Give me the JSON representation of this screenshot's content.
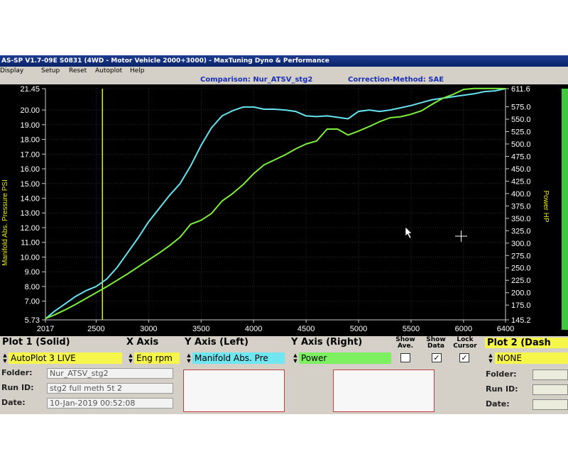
{
  "window": {
    "title": "AS-SP V1.7-09E S0831  (4WD - Motor Vehicle 2000+3000) - MaxTuning Dyno & Performance"
  },
  "menu": [
    "Display",
    "Setup",
    "Reset",
    "Autoplot",
    "Help"
  ],
  "header": {
    "comparison": "Comparison: Nur_ATSV_stg2",
    "correction": "Correction-Method: SAE"
  },
  "colors": {
    "background": "#000000",
    "manifold_trace": "#66e3f0",
    "power_trace": "#7cf03a",
    "cursor_line": "#e8e820",
    "power_bar": "#3ec83e"
  },
  "chart_data": {
    "type": "line",
    "xlabel": "",
    "ylabel_left": "Manifold Abs. Pressure PSI",
    "ylabel_right": "Power HP",
    "xlim": [
      2017,
      6400
    ],
    "ylim_left": [
      5.73,
      21.45
    ],
    "ylim_right": [
      145.2,
      611.6
    ],
    "x_ticks": [
      "2017",
      "2500",
      "3000",
      "3500",
      "4000",
      "4500",
      "5000",
      "5500",
      "6000",
      "6400"
    ],
    "y_left_ticks": [
      "21.45",
      "20.00",
      "19.00",
      "18.00",
      "17.00",
      "16.00",
      "15.00",
      "14.00",
      "13.00",
      "12.00",
      "11.00",
      "10.00",
      "9.00",
      "8.00",
      "7.00",
      "5.73"
    ],
    "y_right_ticks": [
      "611.6",
      "575.0",
      "550.0",
      "525.0",
      "500.0",
      "475.0",
      "450.0",
      "425.0",
      "400.0",
      "375.0",
      "350.0",
      "325.0",
      "300.0",
      "275.0",
      "250.0",
      "225.0",
      "200.0",
      "175.0",
      "145.2"
    ],
    "cursor_rpm": 2560,
    "grid": true,
    "series": [
      {
        "name": "Manifold Abs. Pressure",
        "axis": "left",
        "x": [
          2017,
          2100,
          2200,
          2300,
          2400,
          2500,
          2600,
          2700,
          2800,
          2900,
          3000,
          3100,
          3200,
          3300,
          3400,
          3500,
          3600,
          3700,
          3800,
          3900,
          4000,
          4100,
          4200,
          4300,
          4400,
          4500,
          4600,
          4700,
          4800,
          4900,
          5000,
          5100,
          5200,
          5300,
          5400,
          5500,
          5600,
          5700,
          5800,
          5900,
          6000,
          6100,
          6200,
          6300,
          6400
        ],
        "values": [
          5.8,
          6.3,
          6.8,
          7.3,
          7.7,
          8.0,
          8.5,
          9.3,
          10.3,
          11.3,
          12.4,
          13.3,
          14.2,
          15.0,
          16.2,
          17.6,
          18.8,
          19.6,
          19.95,
          20.2,
          20.2,
          20.05,
          20.05,
          20.0,
          19.9,
          19.6,
          19.55,
          19.6,
          19.5,
          19.4,
          19.9,
          20.0,
          19.9,
          20.0,
          20.15,
          20.3,
          20.5,
          20.7,
          20.8,
          20.9,
          21.0,
          21.1,
          21.25,
          21.3,
          21.45
        ]
      },
      {
        "name": "Power",
        "axis": "right",
        "x": [
          2017,
          2100,
          2200,
          2300,
          2400,
          2500,
          2600,
          2700,
          2800,
          2900,
          3000,
          3100,
          3200,
          3300,
          3400,
          3500,
          3600,
          3700,
          3800,
          3900,
          4000,
          4100,
          4200,
          4300,
          4400,
          4500,
          4600,
          4700,
          4800,
          4900,
          5000,
          5100,
          5200,
          5300,
          5400,
          5500,
          5600,
          5700,
          5800,
          5900,
          6000,
          6100,
          6200,
          6300,
          6400
        ],
        "values": [
          148,
          155,
          165,
          176,
          188,
          200,
          212,
          225,
          238,
          252,
          266,
          280,
          295,
          312,
          338,
          346,
          360,
          385,
          400,
          418,
          440,
          458,
          468,
          478,
          490,
          500,
          506,
          530,
          530,
          518,
          526,
          535,
          545,
          553,
          555,
          560,
          567,
          580,
          592,
          600,
          610,
          612,
          612,
          612,
          611.6
        ]
      }
    ]
  },
  "controls": {
    "plot1": {
      "title": "Plot 1 (Solid)",
      "value": "AutoPlot 3 LIVE"
    },
    "x_axis": {
      "title": "X Axis",
      "value": "Eng rpm"
    },
    "y_axis_left": {
      "title": "Y Axis (Left)",
      "value": "Manifold Abs. Pre"
    },
    "y_axis_right": {
      "title": "Y Axis (Right)",
      "value": "Power"
    },
    "show_ave": {
      "label1": "Show",
      "label2": "Ave.",
      "checked": false
    },
    "show_data": {
      "label1": "Show",
      "label2": "Data",
      "checked": true
    },
    "lock_cursor": {
      "label1": "Lock",
      "label2": "Cursor",
      "checked": true
    },
    "plot2": {
      "title": "Plot 2 (Dash",
      "value": "NONE"
    },
    "folder": {
      "label": "Folder:",
      "value": "Nur_ATSV_stg2"
    },
    "run_id": {
      "label": "Run ID:",
      "value": "stg2 full meth 5t 2"
    },
    "date": {
      "label": "Date:",
      "value": "10-Jan-2019  00:52:08"
    },
    "plot2_folder_label": "Folder:",
    "plot2_run_id_label": "Run ID:",
    "plot2_date_label": "Date:",
    "check_mark": "✓"
  }
}
